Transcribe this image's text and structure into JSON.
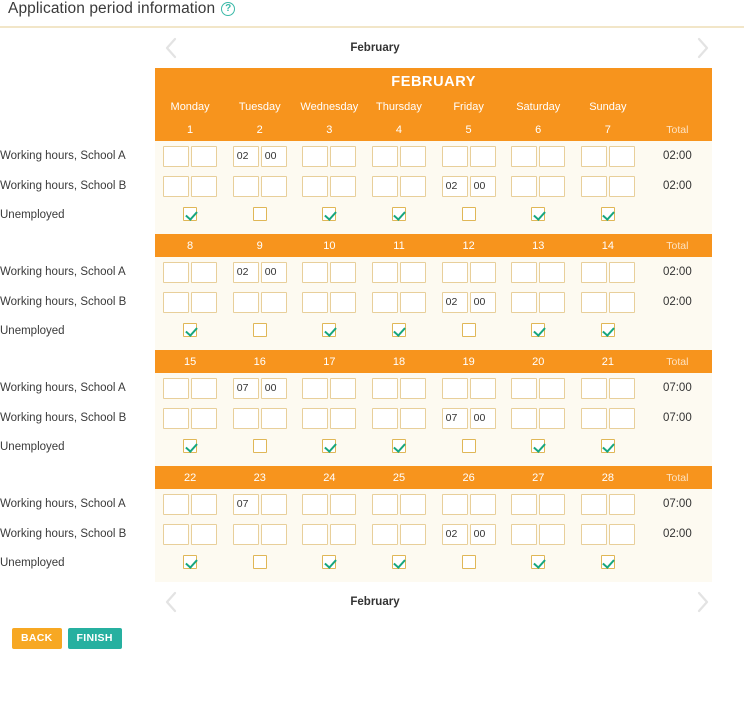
{
  "header": {
    "title": "Application period information",
    "help_icon": "question-mark-circle-icon"
  },
  "nav_top": {
    "prev_icon": "chevron-left-icon",
    "label": "February",
    "next_icon": "chevron-right-icon"
  },
  "nav_bottom": {
    "prev_icon": "chevron-left-icon",
    "label": "February",
    "next_icon": "chevron-right-icon"
  },
  "calendar": {
    "month_banner": "FEBRUARY",
    "day_names": [
      "Monday",
      "Tuesday",
      "Wednesday",
      "Thursday",
      "Friday",
      "Saturday",
      "Sunday"
    ],
    "total_header": "Total",
    "row_labels": {
      "school_a": "Working hours, School A",
      "school_b": "Working hours, School B",
      "unemployed": "Unemployed"
    },
    "weeks": [
      {
        "dates": [
          "1",
          "2",
          "3",
          "4",
          "5",
          "6",
          "7"
        ],
        "school_a": {
          "hours": [
            "",
            "02",
            "",
            "",
            "",
            "",
            ""
          ],
          "minutes": [
            "",
            "00",
            "",
            "",
            "",
            "",
            ""
          ],
          "total": "02:00"
        },
        "school_b": {
          "hours": [
            "",
            "",
            "",
            "",
            "02",
            "",
            ""
          ],
          "minutes": [
            "",
            "",
            "",
            "",
            "00",
            "",
            ""
          ],
          "total": "02:00"
        },
        "unemployed": [
          true,
          false,
          true,
          true,
          false,
          true,
          true
        ]
      },
      {
        "dates": [
          "8",
          "9",
          "10",
          "11",
          "12",
          "13",
          "14"
        ],
        "school_a": {
          "hours": [
            "",
            "02",
            "",
            "",
            "",
            "",
            ""
          ],
          "minutes": [
            "",
            "00",
            "",
            "",
            "",
            "",
            ""
          ],
          "total": "02:00"
        },
        "school_b": {
          "hours": [
            "",
            "",
            "",
            "",
            "02",
            "",
            ""
          ],
          "minutes": [
            "",
            "",
            "",
            "",
            "00",
            "",
            ""
          ],
          "total": "02:00"
        },
        "unemployed": [
          true,
          false,
          true,
          true,
          false,
          true,
          true
        ]
      },
      {
        "dates": [
          "15",
          "16",
          "17",
          "18",
          "19",
          "20",
          "21"
        ],
        "school_a": {
          "hours": [
            "",
            "07",
            "",
            "",
            "",
            "",
            ""
          ],
          "minutes": [
            "",
            "00",
            "",
            "",
            "",
            "",
            ""
          ],
          "total": "07:00"
        },
        "school_b": {
          "hours": [
            "",
            "",
            "",
            "",
            "07",
            "",
            ""
          ],
          "minutes": [
            "",
            "",
            "",
            "",
            "00",
            "",
            ""
          ],
          "total": "07:00"
        },
        "unemployed": [
          true,
          false,
          true,
          true,
          false,
          true,
          true
        ]
      },
      {
        "dates": [
          "22",
          "23",
          "24",
          "25",
          "26",
          "27",
          "28"
        ],
        "school_a": {
          "hours": [
            "",
            "07",
            "",
            "",
            "",
            "",
            ""
          ],
          "minutes": [
            "",
            "",
            "",
            "",
            "",
            "",
            ""
          ],
          "total": "07:00"
        },
        "school_b": {
          "hours": [
            "",
            "",
            "",
            "",
            "02",
            "",
            ""
          ],
          "minutes": [
            "",
            "",
            "",
            "",
            "00",
            "",
            ""
          ],
          "total": "02:00"
        },
        "unemployed": [
          true,
          false,
          true,
          true,
          false,
          true,
          true
        ]
      }
    ]
  },
  "footer": {
    "back_label": "BACK",
    "finish_label": "FINISH"
  },
  "colors": {
    "orange": "#f7941d",
    "cream": "#fdfaf1",
    "teal": "#26b0a0",
    "check_green": "#17a67f",
    "input_border": "#e8cf9a",
    "back_button": "#f7a823"
  }
}
